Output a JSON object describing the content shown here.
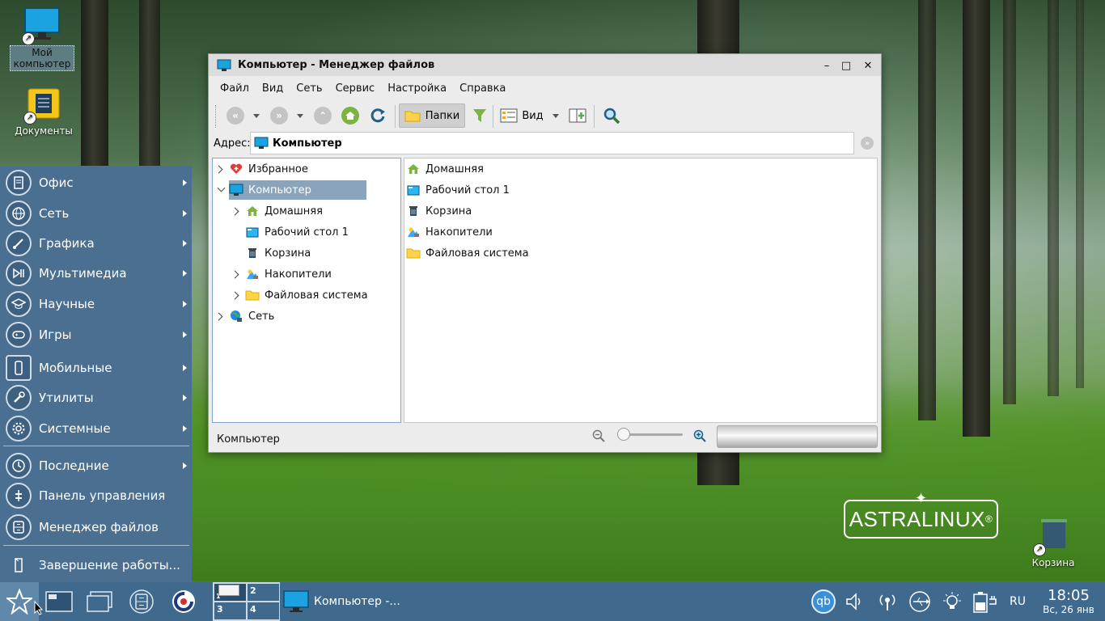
{
  "desktop": {
    "icons": [
      {
        "label": "Мой компьютер"
      },
      {
        "label": "Документы"
      },
      {
        "label": "Корзина"
      }
    ],
    "brand": "ASTRALINUX",
    "brand_mark": "®"
  },
  "start_menu": {
    "items": [
      {
        "label": "Офис",
        "icon": "office-icon",
        "submenu": true
      },
      {
        "label": "Сеть",
        "icon": "globe-icon",
        "submenu": true
      },
      {
        "label": "Графика",
        "icon": "brush-icon",
        "submenu": true
      },
      {
        "label": "Мультимедиа",
        "icon": "media-icon",
        "submenu": true
      },
      {
        "label": "Научные",
        "icon": "graduation-cap-icon",
        "submenu": true
      },
      {
        "label": "Игры",
        "icon": "gamepad-icon",
        "submenu": true
      },
      {
        "label": "Мобильные",
        "icon": "smartphone-icon",
        "submenu": true
      },
      {
        "label": "Утилиты",
        "icon": "wrench-icon",
        "submenu": true
      },
      {
        "label": "Системные",
        "icon": "gear-icon",
        "submenu": true
      },
      {
        "label": "Последние",
        "icon": "clock-icon",
        "submenu": true
      },
      {
        "label": "Панель управления",
        "icon": "control-panel-icon",
        "submenu": false
      },
      {
        "label": "Менеджер файлов",
        "icon": "file-cabinet-icon",
        "submenu": false
      },
      {
        "label": "Завершение работы...",
        "icon": "door-icon",
        "submenu": false
      }
    ]
  },
  "window": {
    "title": "Компьютер - Менеджер файлов",
    "menu": [
      "Файл",
      "Вид",
      "Сеть",
      "Сервис",
      "Настройка",
      "Справка"
    ],
    "toolbar": {
      "folders_label": "Папки",
      "view_label": "Вид"
    },
    "address": {
      "label": "Адрес:",
      "value": "Компьютер"
    },
    "tree": [
      {
        "label": "Избранное",
        "icon": "favorites-heart-icon",
        "level": 0,
        "expander": "collapsed"
      },
      {
        "label": "Компьютер",
        "icon": "computer-icon",
        "level": 0,
        "expander": "expanded",
        "selected": true
      },
      {
        "label": "Домашняя",
        "icon": "home-icon",
        "level": 1,
        "expander": "collapsed"
      },
      {
        "label": "Рабочий стол 1",
        "icon": "desktop-icon",
        "level": 1,
        "expander": "none"
      },
      {
        "label": "Корзина",
        "icon": "trash-icon",
        "level": 1,
        "expander": "none"
      },
      {
        "label": "Накопители",
        "icon": "drives-icon",
        "level": 1,
        "expander": "collapsed"
      },
      {
        "label": "Файловая система",
        "icon": "folder-icon",
        "level": 1,
        "expander": "collapsed"
      },
      {
        "label": "Сеть",
        "icon": "network-icon",
        "level": 0,
        "expander": "collapsed"
      }
    ],
    "items": [
      {
        "label": "Домашняя",
        "icon": "home-icon"
      },
      {
        "label": "Рабочий стол 1",
        "icon": "desktop-icon"
      },
      {
        "label": "Корзина",
        "icon": "trash-icon"
      },
      {
        "label": "Накопители",
        "icon": "drives-icon"
      },
      {
        "label": "Файловая система",
        "icon": "folder-icon"
      }
    ],
    "status": "Компьютер"
  },
  "taskbar": {
    "pager": [
      "1",
      "2",
      "3",
      "4"
    ],
    "task_label": "Компьютер -...",
    "tray": {
      "qb": "qb",
      "lang": "RU"
    },
    "clock": {
      "time": "18:05",
      "date": "Вс, 26 янв"
    }
  },
  "colors": {
    "menu_bg": "#4a6f90",
    "taskbar_bg": "#3f6a8e",
    "accent_blue": "#1e9bd7",
    "selection": "#8aa4bd"
  }
}
